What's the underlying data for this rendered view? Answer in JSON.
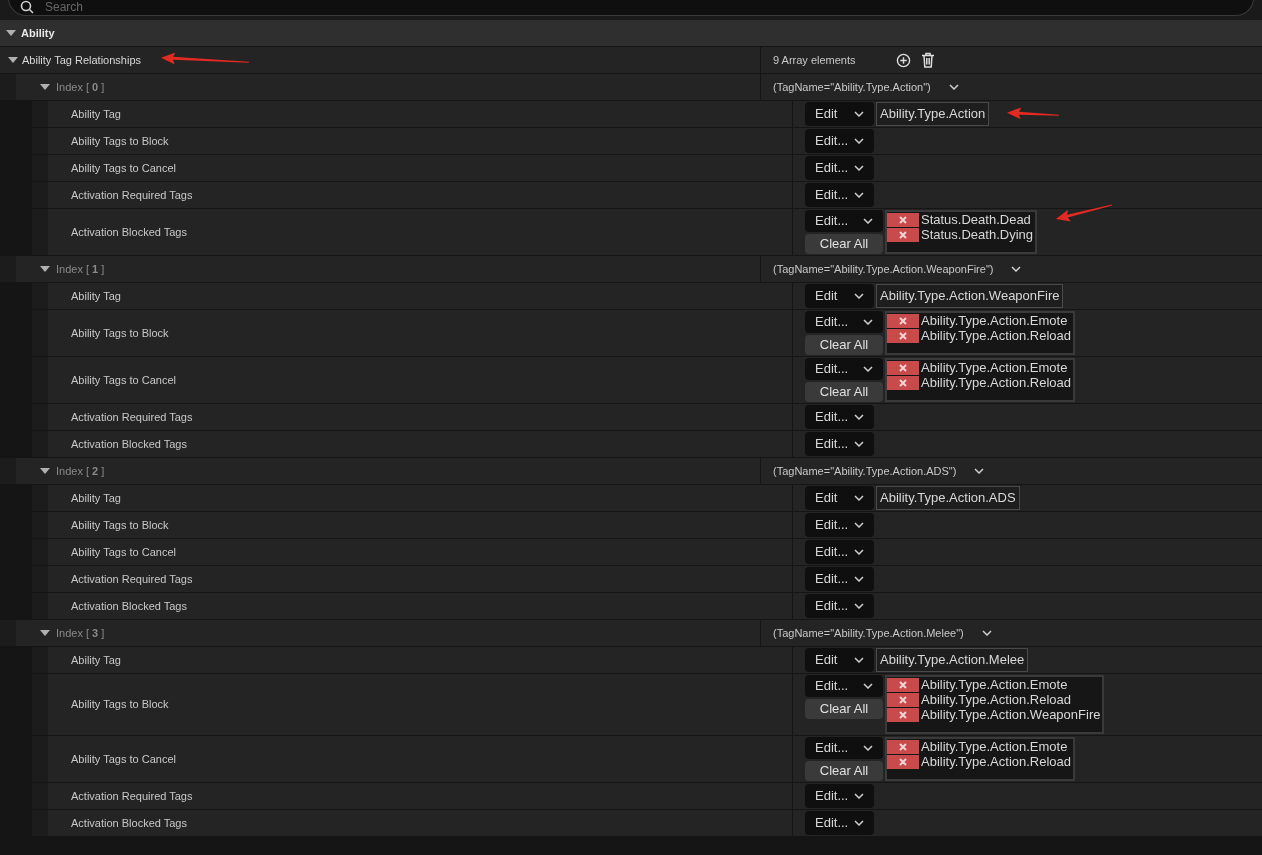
{
  "search": {
    "placeholder": "Search"
  },
  "category": {
    "label": "Ability",
    "expanded": true
  },
  "array": {
    "label": "Ability Tag Relationships",
    "expanded": true,
    "arrow": true,
    "count": "9 Array elements",
    "elements": [
      {
        "label": "Index [ **0** ]",
        "value": "(TagName=\"Ability.Type.Action\")",
        "expanded": true,
        "properties": [
          {
            "label": "Ability Tag",
            "kind": "single",
            "edit": "Edit",
            "tag": "Ability.Type.Action",
            "arrow": true
          },
          {
            "label": "Ability Tags to Block",
            "kind": "empty",
            "edit": "Edit..."
          },
          {
            "label": "Ability Tags to Cancel",
            "kind": "empty",
            "edit": "Edit..."
          },
          {
            "label": "Activation Required Tags",
            "kind": "empty",
            "edit": "Edit..."
          },
          {
            "label": "Activation Blocked Tags",
            "kind": "list",
            "edit": "Edit...",
            "clear": "Clear All",
            "tags": [
              "Status.Death.Dead",
              "Status.Death.Dying"
            ],
            "arrow": true
          }
        ]
      },
      {
        "label": "Index [ **1** ]",
        "value": "(TagName=\"Ability.Type.Action.WeaponFire\")",
        "expanded": true,
        "properties": [
          {
            "label": "Ability Tag",
            "kind": "single",
            "edit": "Edit",
            "tag": "Ability.Type.Action.WeaponFire"
          },
          {
            "label": "Ability Tags to Block",
            "kind": "list",
            "edit": "Edit...",
            "clear": "Clear All",
            "tags": [
              "Ability.Type.Action.Emote",
              "Ability.Type.Action.Reload"
            ]
          },
          {
            "label": "Ability Tags to Cancel",
            "kind": "list",
            "edit": "Edit...",
            "clear": "Clear All",
            "tags": [
              "Ability.Type.Action.Emote",
              "Ability.Type.Action.Reload"
            ]
          },
          {
            "label": "Activation Required Tags",
            "kind": "empty",
            "edit": "Edit..."
          },
          {
            "label": "Activation Blocked Tags",
            "kind": "empty",
            "edit": "Edit..."
          }
        ]
      },
      {
        "label": "Index [ **2** ]",
        "value": "(TagName=\"Ability.Type.Action.ADS\")",
        "expanded": true,
        "properties": [
          {
            "label": "Ability Tag",
            "kind": "single",
            "edit": "Edit",
            "tag": "Ability.Type.Action.ADS"
          },
          {
            "label": "Ability Tags to Block",
            "kind": "empty",
            "edit": "Edit..."
          },
          {
            "label": "Ability Tags to Cancel",
            "kind": "empty",
            "edit": "Edit..."
          },
          {
            "label": "Activation Required Tags",
            "kind": "empty",
            "edit": "Edit..."
          },
          {
            "label": "Activation Blocked Tags",
            "kind": "empty",
            "edit": "Edit..."
          }
        ]
      },
      {
        "label": "Index [ **3** ]",
        "value": "(TagName=\"Ability.Type.Action.Melee\")",
        "expanded": true,
        "properties": [
          {
            "label": "Ability Tag",
            "kind": "single",
            "edit": "Edit",
            "tag": "Ability.Type.Action.Melee"
          },
          {
            "label": "Ability Tags to Block",
            "kind": "list",
            "edit": "Edit...",
            "clear": "Clear All",
            "tags": [
              "Ability.Type.Action.Emote",
              "Ability.Type.Action.Reload",
              "Ability.Type.Action.WeaponFire"
            ]
          },
          {
            "label": "Ability Tags to Cancel",
            "kind": "list",
            "edit": "Edit...",
            "clear": "Clear All",
            "tags": [
              "Ability.Type.Action.Emote",
              "Ability.Type.Action.Reload"
            ]
          },
          {
            "label": "Activation Required Tags",
            "kind": "empty",
            "edit": "Edit..."
          },
          {
            "label": "Activation Blocked Tags",
            "kind": "empty",
            "edit": "Edit..."
          }
        ]
      }
    ]
  }
}
